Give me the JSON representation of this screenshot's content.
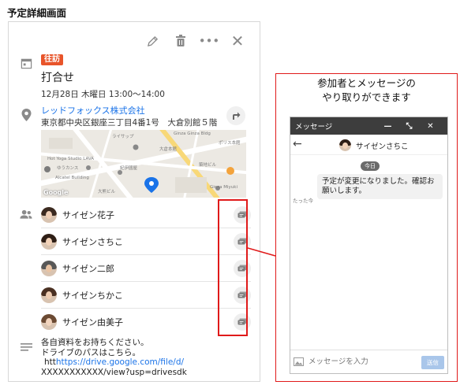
{
  "page_title": "予定詳細画面",
  "toolbar": {
    "edit_icon": "pencil-icon",
    "delete_icon": "trash-icon",
    "more_label": "•••",
    "close_label": "✕"
  },
  "event": {
    "badge": "往訪",
    "title": "打合せ",
    "datetime": "12月28日 木曜日 13:00〜14:00"
  },
  "location": {
    "company": "レッドフォックス株式会社",
    "address": "東京都中央区銀座三丁目4番1号　大倉別館５階",
    "map": {
      "labels": [
        "ライサップ",
        "Hot Yoga Studio LAVA",
        "ゆうカンス",
        "大倉本館",
        "ポリス本館",
        "Ginza Ginza Bldg",
        "Alcatel Building",
        "紀伊國屋",
        "大熊ビル",
        "築地ビル",
        "Ginza Miyuki",
        "Google"
      ]
    }
  },
  "attendees": [
    {
      "name": "サイゼン花子",
      "hair": "#3b2a20",
      "skin": "#f0cfb6"
    },
    {
      "name": "サイゼンさちこ",
      "hair": "#2e1e16",
      "skin": "#f2d2b8"
    },
    {
      "name": "サイゼン二郎",
      "hair": "#585858",
      "skin": "#e9c3a3"
    },
    {
      "name": "サイゼンちかこ",
      "hair": "#4a3022",
      "skin": "#efcdb2"
    },
    {
      "name": "サイゼン由美子",
      "hair": "#6b4a33",
      "skin": "#f2d4bd"
    }
  ],
  "memo": {
    "line1": "各自資料をお持ちください。",
    "line2": "ドライブのパスはこちら。",
    "link_prefix": "htt",
    "link_url": "https://drive.google.com/file/d/",
    "line4": "XXXXXXXXXXX/view?usp=drivesdk"
  },
  "callout": {
    "caption_line1": "参加者とメッセージの",
    "caption_line2": "やり取りができます"
  },
  "chat": {
    "title": "メッセージ",
    "minimize": "—",
    "expand": "⤡",
    "close": "✕",
    "partner_name": "サイゼンさちこ",
    "date_label": "今日",
    "message": "予定が変更になりました。確認お願いします。",
    "sent_time": "たった今",
    "input_placeholder": "メッセージを入力",
    "send_label": "送信"
  }
}
